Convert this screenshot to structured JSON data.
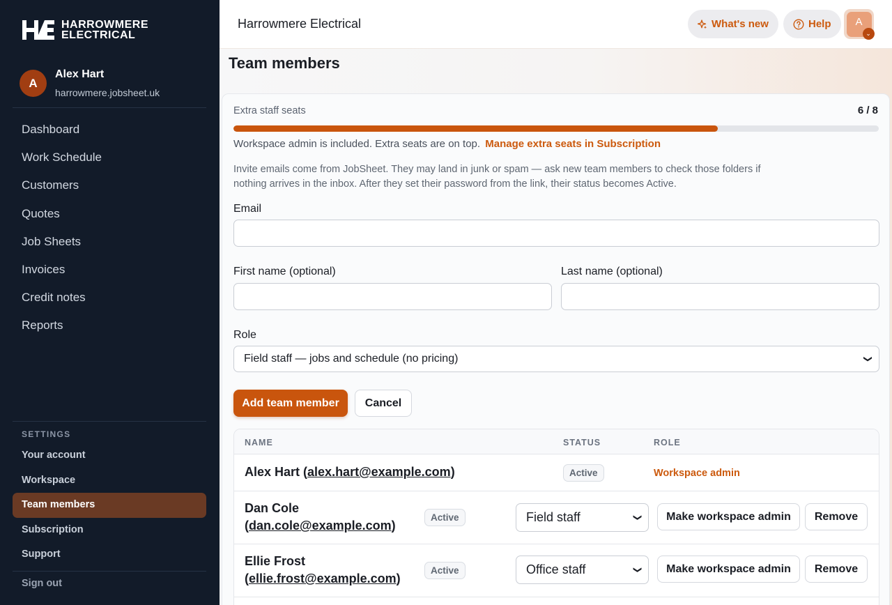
{
  "sidebar": {
    "logo_line1": "HARROWMERE",
    "logo_line2": "ELECTRICAL",
    "user": {
      "initial": "A",
      "name": "Alex Hart",
      "domain": "harrowmere.jobsheet.uk"
    },
    "nav": [
      "Dashboard",
      "Work Schedule",
      "Customers",
      "Quotes",
      "Job Sheets",
      "Invoices",
      "Credit notes",
      "Reports"
    ],
    "settings_label": "SETTINGS",
    "settings": [
      "Your account",
      "Workspace",
      "Team members",
      "Subscription",
      "Support"
    ],
    "active_setting": "Team members",
    "sign_out": "Sign out"
  },
  "topbar": {
    "brand": "Harrowmere Electrical",
    "whats_new": "What's new",
    "help": "Help",
    "avatar_initial": "A"
  },
  "page": {
    "title": "Team members",
    "seats": {
      "label": "Extra staff seats",
      "count_text": "6 / 8",
      "used": 6,
      "total": 8,
      "note": "Workspace admin is included. Extra seats are on top.",
      "link": "Manage extra seats in Subscription"
    },
    "invite_note": "Invite emails come from JobSheet. They may land in junk or spam — ask new team members to check those folders if nothing arrives in the inbox. After they set their password from the link, their status becomes Active.",
    "form": {
      "email_label": "Email",
      "first_label": "First name (optional)",
      "last_label": "Last name (optional)",
      "role_label": "Role",
      "role_value": "Field staff — jobs and schedule (no pricing)",
      "add_button": "Add team member",
      "cancel_button": "Cancel"
    },
    "table": {
      "headers": {
        "name": "NAME",
        "status": "STATUS",
        "role": "ROLE"
      },
      "rows": [
        {
          "name": "Alex Hart",
          "email": "alex.hart@example.com",
          "status": "Active",
          "role": "Workspace admin"
        },
        {
          "name": "Dan Cole",
          "email": "dan.cole@example.com",
          "status": "Active",
          "role": "Field staff",
          "make_admin": "Make workspace admin",
          "remove": "Remove"
        },
        {
          "name": "Ellie Frost",
          "email": "ellie.frost@example.com",
          "status": "Active",
          "role": "Office staff",
          "make_admin": "Make workspace admin",
          "remove": "Remove"
        }
      ]
    }
  },
  "colors": {
    "accent": "#c9550d",
    "sidebar_bg": "#121b29",
    "active_item": "#6a3a24"
  }
}
